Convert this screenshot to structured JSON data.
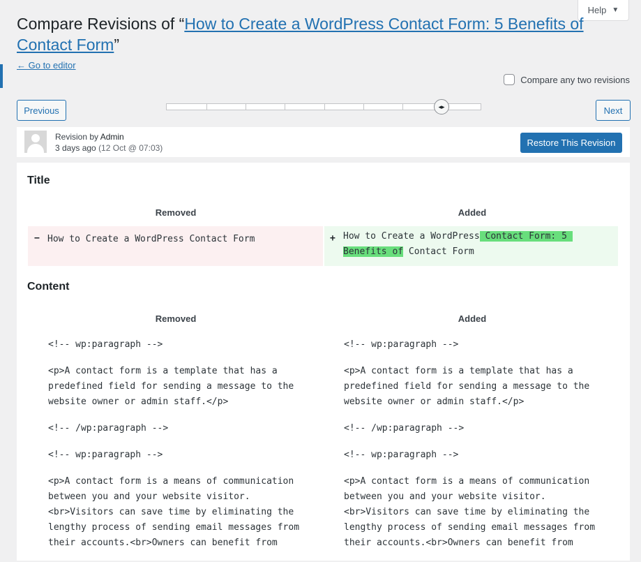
{
  "help": {
    "label": "Help",
    "caret": "▼"
  },
  "header": {
    "title_prefix": "Compare Revisions of “",
    "title_link": "How to Create a WordPress Contact Form: 5 Benefits of Contact Form",
    "title_suffix": "”",
    "back_link": "← Go to editor",
    "compare_toggle_label": "Compare any two revisions"
  },
  "navigation": {
    "previous": "Previous",
    "next": "Next",
    "handle_glyph": "◂▸"
  },
  "revision": {
    "by_text": "Revision by ",
    "author": "Admin",
    "ago": "3 days ago",
    "date": "(12 Oct @ 07:03)",
    "restore_label": "Restore This Revision"
  },
  "diff": {
    "title_section": {
      "heading": "Title",
      "removed_header": "Removed",
      "added_header": "Added",
      "removed_sign": "−",
      "added_sign": "+",
      "removed_text": "How to Create a WordPress Contact Form",
      "added_text_before": "How to Create a WordPress",
      "added_text_highlight_line1": " Contact Form: 5 ",
      "added_text_highlight_line2": "Benefits of",
      "added_text_after": " Contact Form"
    },
    "content_section": {
      "heading": "Content",
      "removed_header": "Removed",
      "added_header": "Added",
      "paragraphs": [
        "<!-- wp:paragraph -->",
        "<p>A contact form is a template that has a\npredefined field for sending a message to the\nwebsite owner or admin staff.</p>",
        "<!-- /wp:paragraph -->",
        "<!-- wp:paragraph -->",
        "<p>A contact form is a means of communication\nbetween you and your website visitor.\n<br>Visitors can save time by eliminating the\nlengthy process of sending email messages from\ntheir accounts.<br>Owners can benefit from"
      ]
    }
  }
}
